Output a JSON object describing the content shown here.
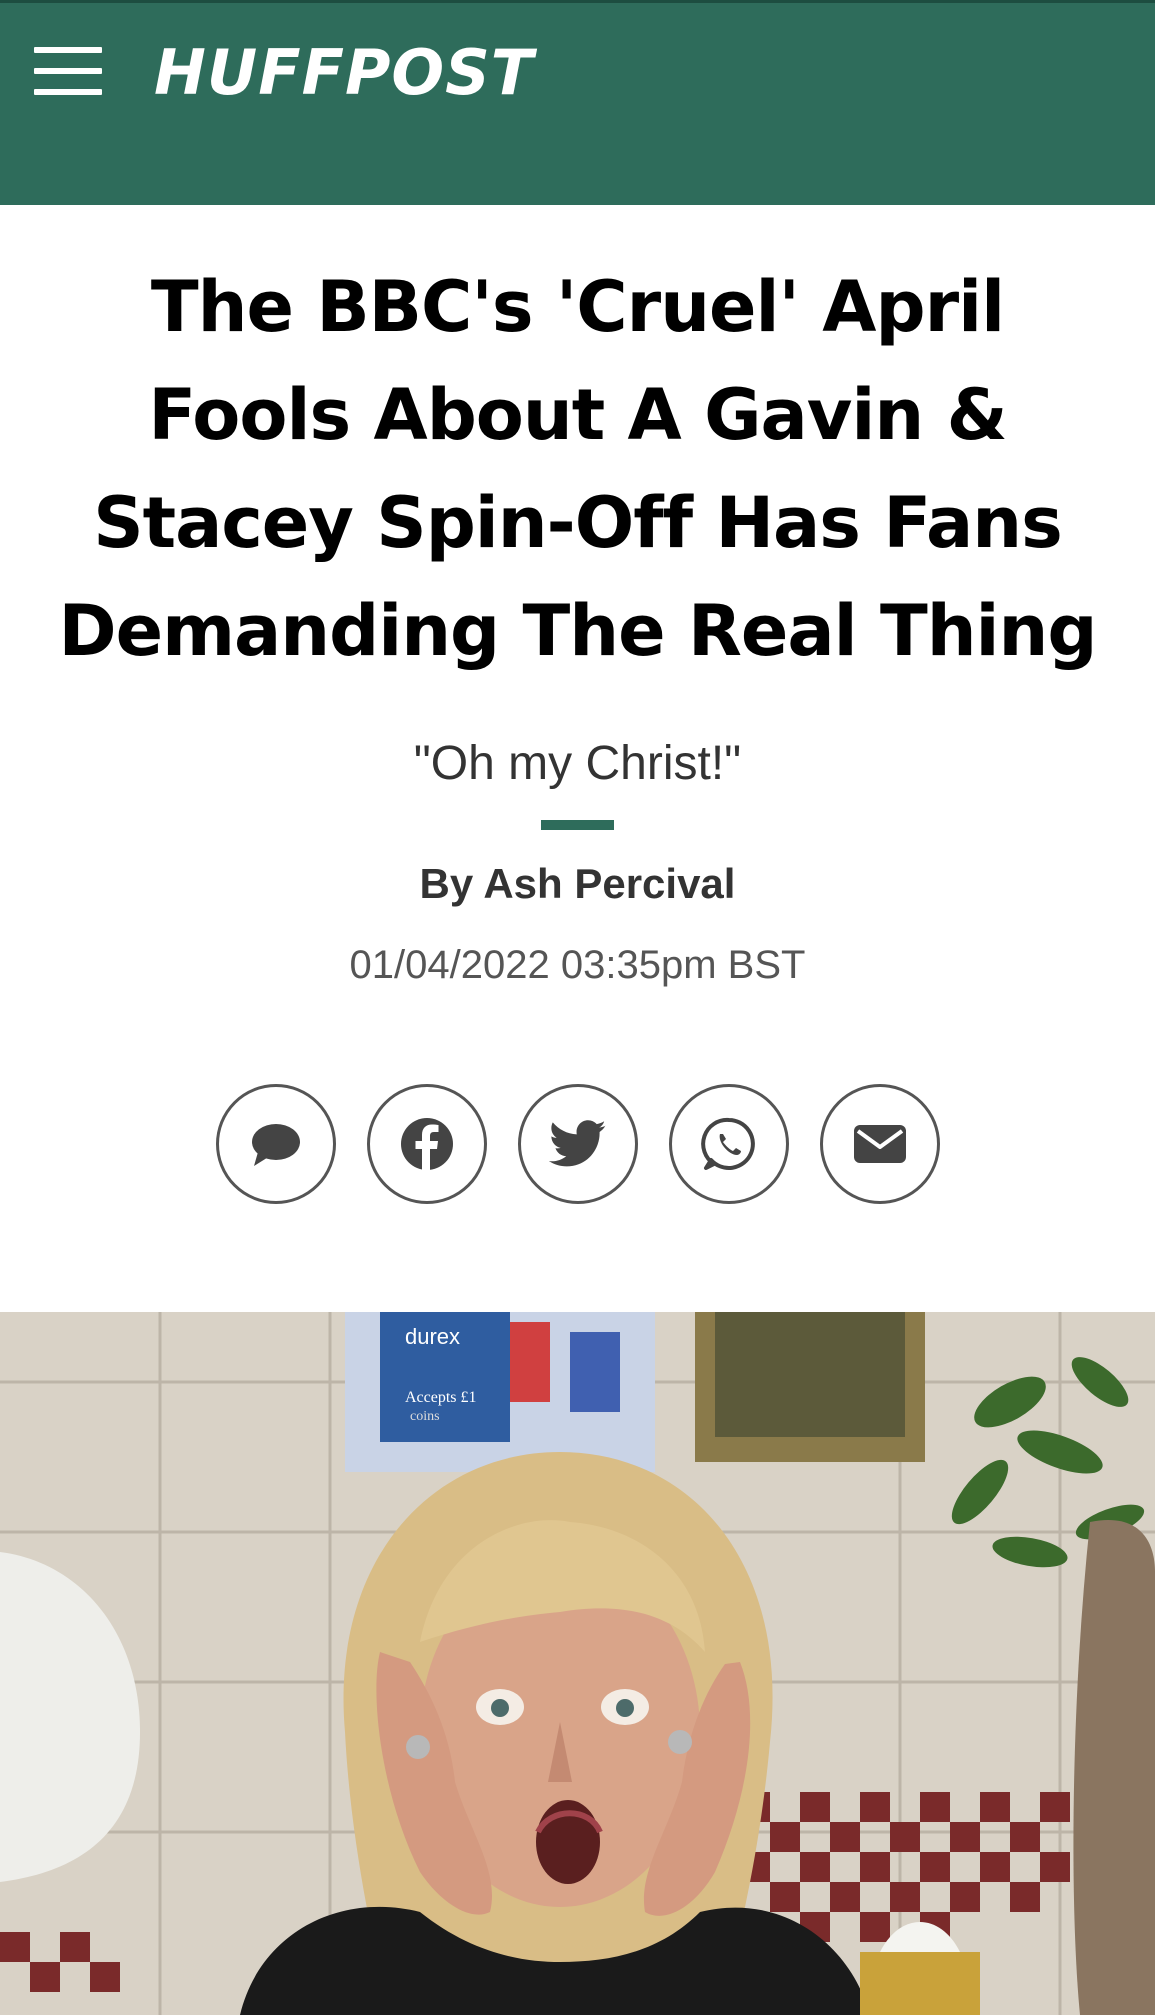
{
  "header": {
    "brand": "HUFFPOST",
    "menu_icon": "hamburger-menu-icon",
    "colors": {
      "bar": "#2e6c5b",
      "text": "#ffffff"
    }
  },
  "article": {
    "headline_lines": [
      "The BBC's 'Cruel' April",
      "Fools About A Gavin &",
      "Stacey Spin-Off Has Fans",
      "Demanding The Real Thing"
    ],
    "subhead": "\"Oh my Christ!\"",
    "byline": "By Ash Percival",
    "timestamp": "01/04/2022 03:35pm BST"
  },
  "share": {
    "buttons": [
      {
        "name": "comment",
        "icon": "comment-icon"
      },
      {
        "name": "facebook",
        "icon": "facebook-icon"
      },
      {
        "name": "twitter",
        "icon": "twitter-icon"
      },
      {
        "name": "whatsapp",
        "icon": "whatsapp-icon"
      },
      {
        "name": "email",
        "icon": "email-icon"
      }
    ]
  },
  "hero_image": {
    "signage_text": [
      "durex",
      "Accepts £1",
      "coins"
    ]
  },
  "colors": {
    "accent": "#2e6c5b",
    "headline": "#000000",
    "meta": "#555555"
  }
}
